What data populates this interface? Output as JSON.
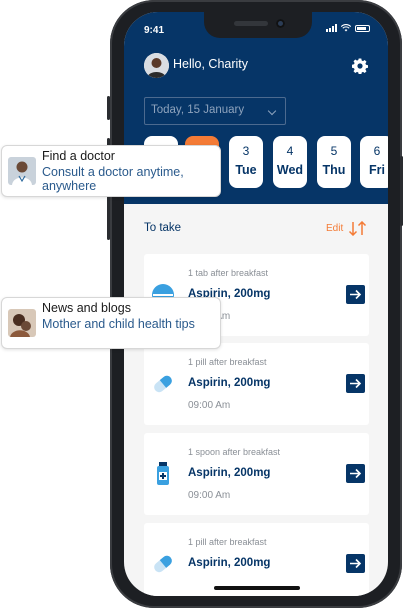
{
  "status": {
    "time": "9:41"
  },
  "header": {
    "greeting": "Hello, Charity",
    "date_select": "Today, 15 January"
  },
  "days": [
    {
      "num": "",
      "name": "",
      "active": false
    },
    {
      "num": "",
      "name": "",
      "active": true
    },
    {
      "num": "3",
      "name": "Tue",
      "active": false
    },
    {
      "num": "4",
      "name": "Wed",
      "active": false
    },
    {
      "num": "5",
      "name": "Thu",
      "active": false
    },
    {
      "num": "6",
      "name": "Fri",
      "active": false
    }
  ],
  "section": {
    "title": "To take",
    "edit": "Edit"
  },
  "meds": [
    {
      "instruction": "1 tab after breakfast",
      "name": "Aspirin, 200mg",
      "time": "09:00 Am",
      "icon": "pill-round-icon"
    },
    {
      "instruction": "1 pill after breakfast",
      "name": "Aspirin, 200mg",
      "time": "09:00 Am",
      "icon": "capsule-icon"
    },
    {
      "instruction": "1 spoon after breakfast",
      "name": "Aspirin, 200mg",
      "time": "09:00 Am",
      "icon": "bottle-icon"
    },
    {
      "instruction": "1 pill after breakfast",
      "name": "Aspirin, 200mg",
      "time": "",
      "icon": "capsule-icon"
    }
  ],
  "popups": [
    {
      "title": "Find a doctor",
      "body": "Consult a doctor anytime, anywhere"
    },
    {
      "title": "News and blogs",
      "body": "Mother and child health tips"
    }
  ],
  "colors": {
    "navy": "#063567",
    "accent": "#f47b36",
    "bg": "#f5f5f5"
  }
}
